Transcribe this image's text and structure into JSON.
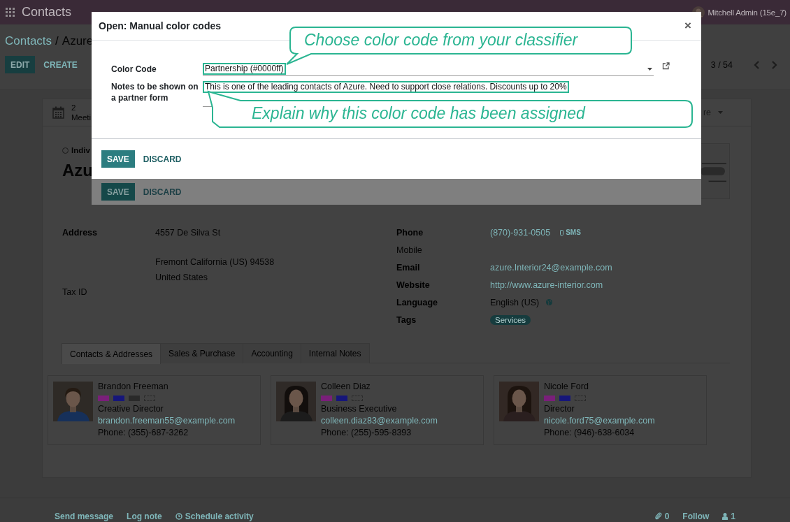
{
  "navbar": {
    "app_name": "Contacts",
    "user": "Mitchell Admin (15e_7)"
  },
  "breadcrumb": {
    "parent": "Contacts",
    "separator": "/",
    "current": "Azure"
  },
  "actions": [
    {
      "label": "EDIT",
      "kind": "primary"
    },
    {
      "label": "CREATE",
      "kind": "secondary"
    }
  ],
  "pager": "3 / 54",
  "smart_buttons": [
    {
      "count": "2",
      "label": "Meeti"
    }
  ],
  "more_button": "re",
  "partner_type": {
    "label": "Indiv",
    "selected": false
  },
  "name": "Azu",
  "background_form_buttons": [
    {
      "label": "SAVE",
      "kind": "primary"
    },
    {
      "label": "DISCARD",
      "kind": "link"
    }
  ],
  "address": {
    "label": "Address",
    "street": "4557 De Silva St",
    "city_line": "Fremont  California (US)  94538",
    "country": "United States"
  },
  "tax_id": {
    "label": "Tax ID"
  },
  "details": [
    {
      "label": "Phone",
      "kind": "phone",
      "value": "(870)-931-0505",
      "action": "SMS"
    },
    {
      "label": "Mobile",
      "kind": "empty"
    },
    {
      "label": "Email",
      "kind": "link",
      "value": "azure.Interior24@example.com"
    },
    {
      "label": "Website",
      "kind": "link",
      "value": "http://www.azure-interior.com"
    },
    {
      "label": "Language",
      "kind": "language",
      "value": "English (US)"
    },
    {
      "label": "Tags",
      "kind": "tag",
      "value": "Services"
    }
  ],
  "tabs": [
    {
      "label": "Contacts & Addresses",
      "selected": true
    },
    {
      "label": "Sales & Purchase",
      "selected": false
    },
    {
      "label": "Accounting",
      "selected": false
    },
    {
      "label": "Internal Notes",
      "selected": false
    }
  ],
  "contacts": [
    {
      "name": "Brandon Freeman",
      "tags": [
        {
          "kind": "fill",
          "color": "#7a1f7a"
        },
        {
          "kind": "fill",
          "color": "#16167a"
        },
        {
          "kind": "fill",
          "color": "#2a2a2a"
        },
        {
          "kind": "outline"
        }
      ],
      "job": "Creative Director",
      "email": "brandon.freeman55@example.com",
      "phone": "Phone: (355)-687-3262"
    },
    {
      "name": "Colleen Diaz",
      "tags": [
        {
          "kind": "fill",
          "color": "#7a1f7a"
        },
        {
          "kind": "fill",
          "color": "#16167a"
        },
        {
          "kind": "outline"
        }
      ],
      "job": "Business Executive",
      "email": "colleen.diaz83@example.com",
      "phone": "Phone: (255)-595-8393"
    },
    {
      "name": "Nicole Ford",
      "tags": [
        {
          "kind": "fill",
          "color": "#7a1f7a"
        },
        {
          "kind": "fill",
          "color": "#16167a"
        },
        {
          "kind": "outline"
        }
      ],
      "job": "Director",
      "email": "nicole.ford75@example.com",
      "phone": "Phone: (946)-638-6034"
    }
  ],
  "chatter": {
    "send_message": "Send message",
    "log_note": "Log note",
    "schedule_activity": "Schedule activity",
    "attachments": "0",
    "follow": "Follow",
    "followers": "1"
  },
  "dialog": {
    "title": "Open: Manual color codes",
    "close": "×",
    "fields": [
      {
        "label": "Color Code",
        "kind": "many2one",
        "value": "Partnership (#0000ff)"
      },
      {
        "label": "Notes to be shown on a partner form",
        "kind": "text",
        "value": "This is one of the leading contacts of Azure. Need to support close relations. Discounts up to 20%"
      }
    ],
    "buttons": [
      {
        "label": "SAVE",
        "kind": "primary"
      },
      {
        "label": "DISCARD",
        "kind": "link"
      }
    ]
  },
  "callouts": [
    {
      "text": "Choose color code from your classifier",
      "kind": "tail_down"
    },
    {
      "text": "Explain why this color code has been assigned",
      "kind": "tail_up"
    }
  ]
}
